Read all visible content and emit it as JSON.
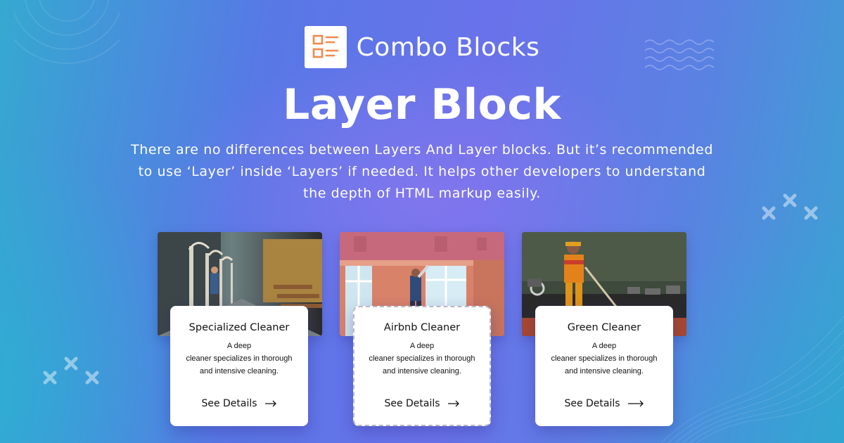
{
  "brand": {
    "logo_icon": "list-layout-icon",
    "name": "Combo Blocks",
    "accent_color": "#f28a4a"
  },
  "hero": {
    "title": "Layer Block",
    "description_lines": [
      "There are no differences between Layers And Layer blocks. But it’s recommended",
      "to use ‘Layer’ inside ‘Layers’ if needed. It helps other developers to understand",
      "the depth of HTML markup easily."
    ]
  },
  "cards": [
    {
      "image": "photo-arcade-corridor-cleaner",
      "title": "Specialized Cleaner",
      "description_lines": [
        "A deep",
        "cleaner specializes in thorough",
        "and intensive cleaning."
      ],
      "link_label": "See Details",
      "link_icon": "arrow-right-icon"
    },
    {
      "image": "photo-window-cleaner",
      "title": "Airbnb Cleaner",
      "description_lines": [
        "A deep",
        "cleaner specializes in thorough",
        "and intensive cleaning."
      ],
      "link_label": "See Details",
      "link_icon": "arrow-right-icon"
    },
    {
      "image": "photo-street-sweeper",
      "title": "Green Cleaner",
      "description_lines": [
        "A deep",
        "cleaner specializes in thorough",
        "and intensive cleaning."
      ],
      "link_label": "See Details",
      "link_icon": "long-arrow-right-icon"
    }
  ]
}
